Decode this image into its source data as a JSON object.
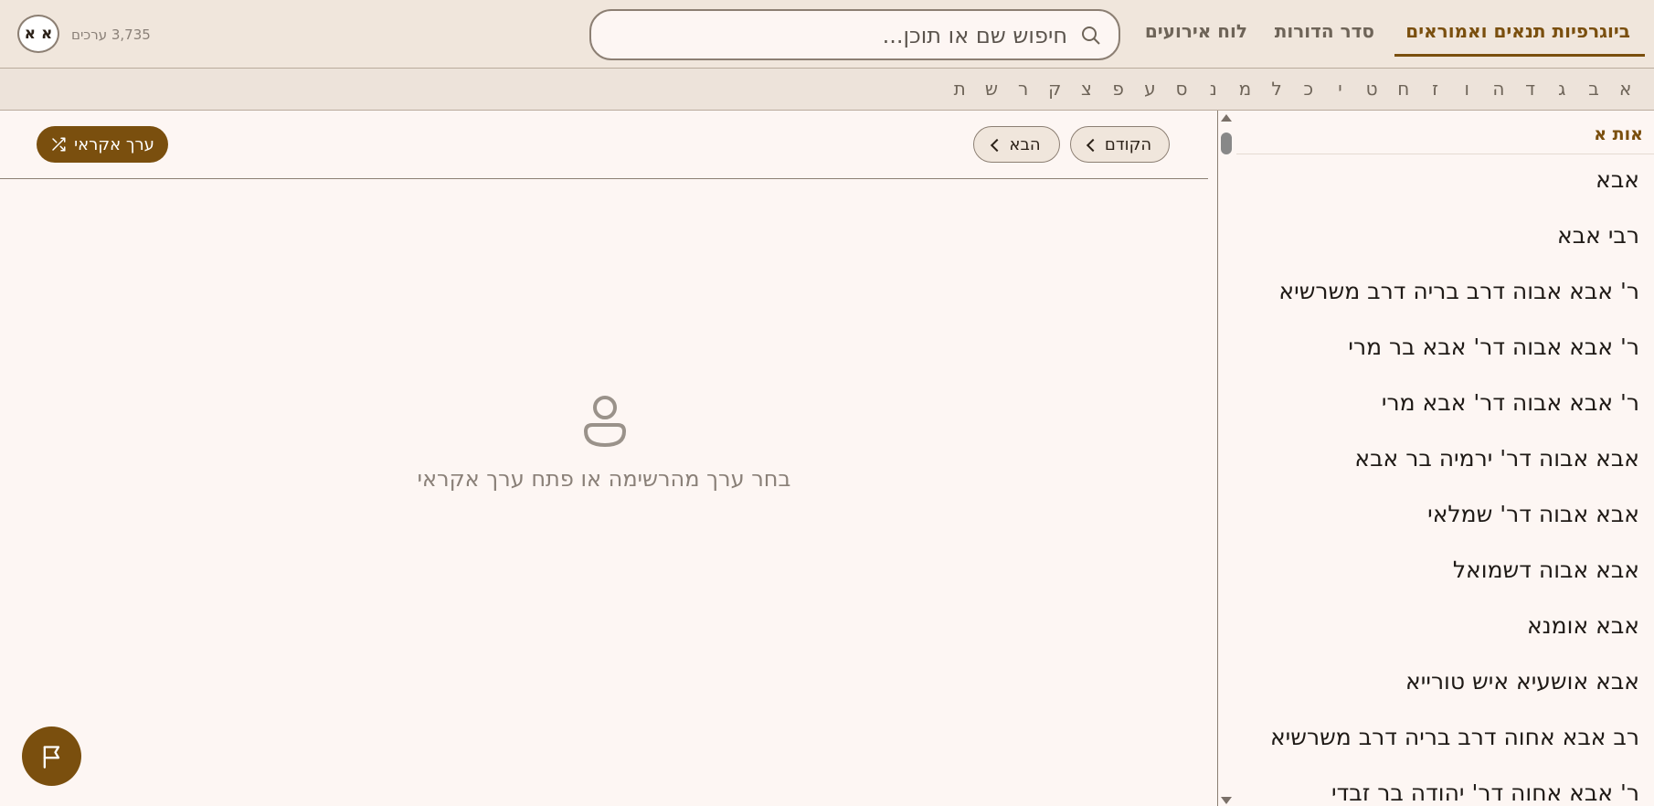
{
  "header": {
    "tabs": [
      {
        "label": "ביוגרפיות תנאים ואמוראים",
        "active": true
      },
      {
        "label": "סדר הדורות",
        "active": false
      },
      {
        "label": "לוח אירועים",
        "active": false
      }
    ],
    "search_placeholder": "חיפוש שם או תוכן...",
    "entry_count": "3,735 ערכים",
    "font_toggle_label": "א א"
  },
  "alphabet": [
    "א",
    "ב",
    "ג",
    "ד",
    "ה",
    "ו",
    "ז",
    "ח",
    "ט",
    "י",
    "כ",
    "ל",
    "מ",
    "נ",
    "ס",
    "ע",
    "פ",
    "צ",
    "ק",
    "ר",
    "ש",
    "ת"
  ],
  "sidebar": {
    "heading": "אות א",
    "entries": [
      "אבא",
      "רבי אבא",
      "ר' אבא אבוה דרב בריה דרב משרשיא",
      "ר' אבא אבוה דר' אבא בר מרי",
      "ר' אבא אבוה דר' אבא מרי",
      "אבא אבוה דר' ירמיה בר אבא",
      "אבא אבוה דר' שמלאי",
      "אבא אבוה דשמואל",
      "אבא אומנא",
      "אבא אושעיא איש טורייא",
      "רב אבא אחוה דרב בריה דרב משרשיא",
      "ר' אבא אחוה דר' יהודה בר זבדי"
    ]
  },
  "toolbar": {
    "prev_label": "הקודם",
    "next_label": "הבא",
    "random_label": "ערך אקראי"
  },
  "empty_state": {
    "message": "בחר ערך מהרשימה או פתח ערך אקראי",
    "icon": "person-icon"
  },
  "report_button": {
    "icon": "flag-icon"
  },
  "colors": {
    "accent": "#7a4f0e",
    "header_bg": "#f0e6dc",
    "page_bg": "#fdf6f3"
  }
}
